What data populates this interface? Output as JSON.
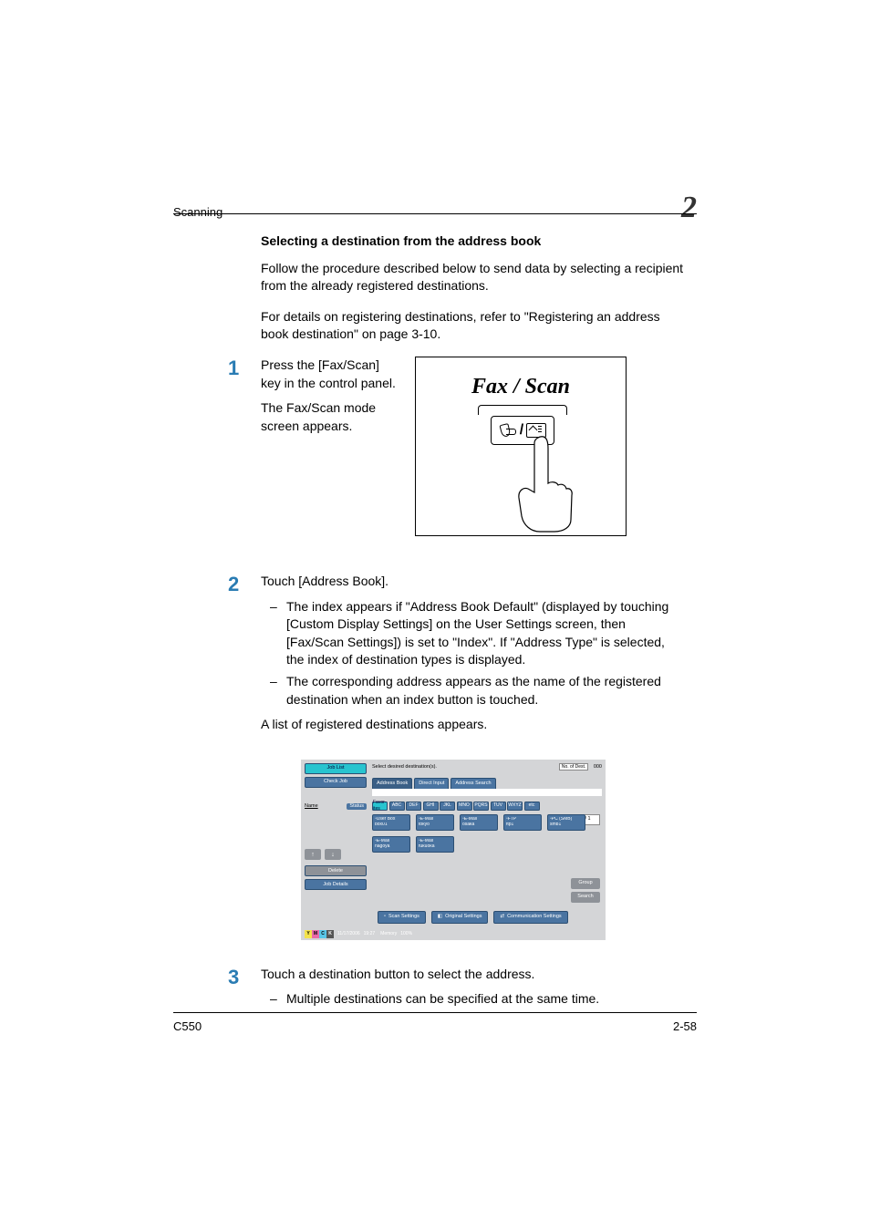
{
  "header": {
    "running": "Scanning",
    "chapter": "2"
  },
  "section": {
    "title": "Selecting a destination from the address book",
    "intro1": "Follow the procedure described below to send data by selecting a recipient from the already registered destinations.",
    "intro2": "For details on registering destinations, refer to \"Registering an address book destination\" on page 3-10."
  },
  "steps": {
    "one": {
      "num": "1",
      "l1": "Press the [Fax/Scan] key in the control panel.",
      "l2": "The Fax/Scan mode screen appears."
    },
    "key_diagram": {
      "label": "Fax / Scan"
    },
    "two": {
      "num": "2",
      "l1": "Touch [Address Book].",
      "b1": "The index appears if \"Address Book Default\" (displayed by touching [Custom Display Settings] on the User Settings screen, then [Fax/Scan Settings]) is set to \"Index\". If \"Address Type\" is selected, the index of destination types is displayed.",
      "b2": "The corresponding address appears as the name of the registered destination when an index button is touched.",
      "after": "A list of registered destinations appears."
    },
    "three": {
      "num": "3",
      "l1": "Touch a destination button to select the address.",
      "b1": "Multiple destinations can be specified at the same time."
    }
  },
  "screenshot": {
    "top_msg": "Select desired destination(s).",
    "nodest": "No. of Dest.",
    "nodest_val": "000",
    "left": {
      "job_list": "Job List",
      "check_job": "Check Job",
      "name_hdr": "Name",
      "status_hdr": "Status",
      "delete": "Delete",
      "job_details": "Job Details"
    },
    "tabs": {
      "addr": "Address Book",
      "direct": "Direct Input",
      "search": "Address Search"
    },
    "alpha": [
      "Favor-ites",
      "ABC",
      "DEF",
      "GHI",
      "JKL",
      "MNO",
      "PQRS",
      "TUV",
      "WXYZ",
      "etc"
    ],
    "page": "1/  1",
    "dest_row1": [
      {
        "t": "▫User Box",
        "n": "box01"
      },
      {
        "t": "▫E-Mail",
        "n": "tokyo"
      },
      {
        "t": "▫E-Mail",
        "n": "osaka"
      },
      {
        "t": "▫FTP",
        "n": "ftp1"
      },
      {
        "t": "▫PC (SMB)",
        "n": "smb1"
      }
    ],
    "dest_row2": [
      {
        "t": "▫E-Mail",
        "n": "nagoya"
      },
      {
        "t": "▫E-Mail",
        "n": "fukuoka"
      }
    ],
    "right_btns": {
      "group": "Group",
      "search": "Search"
    },
    "bottom": {
      "scan": "Scan Settings",
      "orig": "Original Settings",
      "comm": "Communication Settings"
    },
    "footer": {
      "date": "11/17/2006",
      "time": "19:27",
      "mem_label": "Memory",
      "mem_val": "100%"
    },
    "toner": {
      "y": "Y",
      "m": "M",
      "c": "C",
      "k": "K"
    }
  },
  "footer": {
    "left": "C550",
    "right": "2-58"
  }
}
